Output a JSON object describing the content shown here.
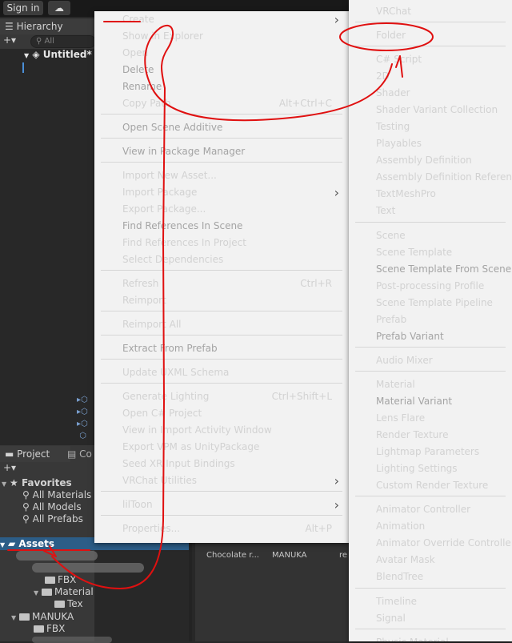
{
  "toolbar": {
    "signin_label": "Sign in",
    "cloud_icon": "cloud-icon"
  },
  "hierarchy": {
    "tab_label": "Hierarchy",
    "plus_label": "+▾",
    "search_placeholder": "All",
    "scene_name": "Untitled*"
  },
  "project": {
    "tab_project": "Project",
    "tab_console": "Co",
    "plus_label": "+▾",
    "favorites_label": "Favorites",
    "favorites": [
      "All Materials",
      "All Models",
      "All Prefabs"
    ],
    "assets_label": "Assets",
    "tree": {
      "fbx1": "FBX",
      "material": "Material",
      "tex": "Tex",
      "manuka": "MANUKA",
      "fbx2": "FBX"
    },
    "grid_items": [
      "Chocolate r...",
      "MANUKA",
      "re"
    ]
  },
  "main_menu": {
    "items": [
      {
        "label": "Create",
        "submenu": true
      },
      {
        "label": "Show in Explorer"
      },
      {
        "label": "Open"
      },
      {
        "label": "Delete",
        "disabled": true
      },
      {
        "label": "Rename",
        "disabled": true
      },
      {
        "label": "Copy Path",
        "shortcut": "Alt+Ctrl+C"
      },
      {
        "label": "Open Scene Additive",
        "disabled": true
      },
      {
        "label": "View in Package Manager",
        "disabled": true
      },
      {
        "label": "Import New Asset..."
      },
      {
        "label": "Import Package",
        "submenu": true
      },
      {
        "label": "Export Package..."
      },
      {
        "label": "Find References In Scene",
        "disabled": true
      },
      {
        "label": "Find References In Project"
      },
      {
        "label": "Select Dependencies"
      },
      {
        "label": "Refresh",
        "shortcut": "Ctrl+R"
      },
      {
        "label": "Reimport"
      },
      {
        "label": "Reimport All"
      },
      {
        "label": "Extract From Prefab",
        "disabled": true
      },
      {
        "label": "Update UXML Schema"
      },
      {
        "label": "Generate Lighting",
        "shortcut": "Ctrl+Shift+L"
      },
      {
        "label": "Open C# Project"
      },
      {
        "label": "View in Import Activity Window"
      },
      {
        "label": "Export VPM as UnityPackage"
      },
      {
        "label": "Seed XR Input Bindings"
      },
      {
        "label": "VRChat Utilities",
        "submenu": true
      },
      {
        "label": "lilToon",
        "submenu": true
      },
      {
        "label": "Properties...",
        "shortcut": "Alt+P"
      }
    ]
  },
  "create_menu": {
    "items": [
      {
        "label": "VRChat"
      },
      {
        "label": "Folder"
      },
      {
        "label": "C# Script"
      },
      {
        "label": "2D"
      },
      {
        "label": "Shader"
      },
      {
        "label": "Shader Variant Collection"
      },
      {
        "label": "Testing"
      },
      {
        "label": "Playables"
      },
      {
        "label": "Assembly Definition"
      },
      {
        "label": "Assembly Definition Reference"
      },
      {
        "label": "TextMeshPro"
      },
      {
        "label": "Text"
      },
      {
        "label": "Scene"
      },
      {
        "label": "Scene Template"
      },
      {
        "label": "Scene Template From Scene",
        "disabled": true
      },
      {
        "label": "Post-processing Profile"
      },
      {
        "label": "Scene Template Pipeline"
      },
      {
        "label": "Prefab"
      },
      {
        "label": "Prefab Variant",
        "disabled": true
      },
      {
        "label": "Audio Mixer"
      },
      {
        "label": "Material"
      },
      {
        "label": "Material Variant",
        "disabled": true
      },
      {
        "label": "Lens Flare"
      },
      {
        "label": "Render Texture"
      },
      {
        "label": "Lightmap Parameters"
      },
      {
        "label": "Lighting Settings"
      },
      {
        "label": "Custom Render Texture"
      },
      {
        "label": "Animator Controller"
      },
      {
        "label": "Animation"
      },
      {
        "label": "Animator Override Controller"
      },
      {
        "label": "Avatar Mask"
      },
      {
        "label": "BlendTree"
      },
      {
        "label": "Timeline"
      },
      {
        "label": "Signal"
      },
      {
        "label": "Physic Material"
      }
    ]
  },
  "colors": {
    "annotation": "#e01010",
    "selection": "#2c5d87",
    "menu_bg": "#f2f2f2"
  }
}
